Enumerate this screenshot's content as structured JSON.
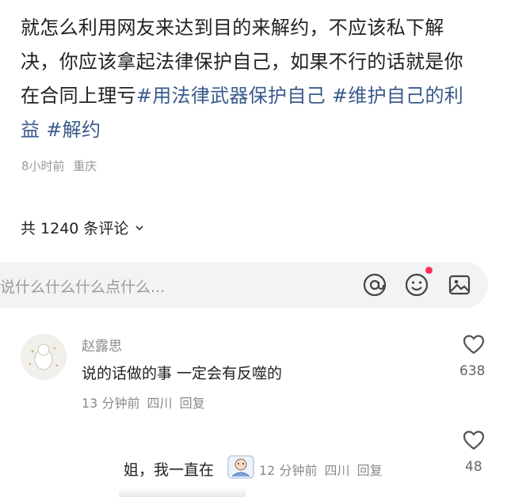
{
  "post": {
    "text_lines": [
      "就怎么利用网友来达到目的来解约，不应该私下解",
      "决，你应该拿起法律保护自己，如果不行的话就是你",
      "在合同上理亏"
    ],
    "tags": [
      "#用法律武器保护自己",
      "#维护自己的利",
      "益",
      "#解约"
    ],
    "time": "8小时前",
    "location": "重庆"
  },
  "comments_header": {
    "label": "共 1240 条评论"
  },
  "input": {
    "placeholder": "说什么什么什么点什么..."
  },
  "icons": {
    "mention": "at-icon",
    "emoji": "emoji-icon",
    "image": "image-icon",
    "like": "heart-icon",
    "chevron": "chevron-down-icon"
  },
  "comment": {
    "name": "赵露思",
    "text": "说的话做的事 一定会有反噬的",
    "time": "13 分钟前",
    "location": "四川",
    "reply_label": "回复",
    "likes": "638"
  },
  "reply": {
    "text": "姐，我一直在",
    "time": "12 分钟前",
    "location": "四川",
    "reply_label": "回复",
    "likes": "48"
  },
  "colors": {
    "tag": "#3a5a8c",
    "meta": "#999999",
    "input_bg": "#f3f3f5",
    "notify_dot": "#ff2d55"
  }
}
